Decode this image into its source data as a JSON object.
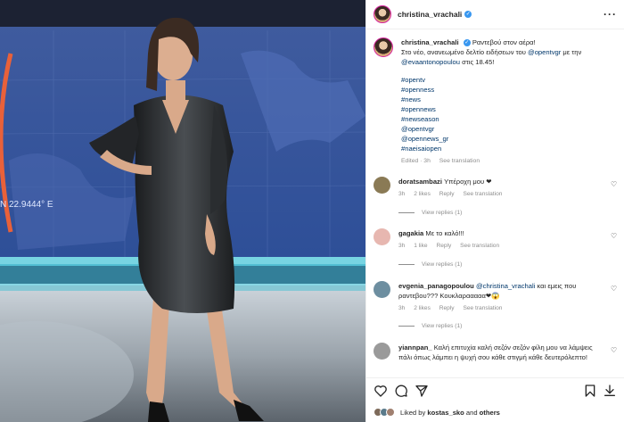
{
  "post": {
    "author": "christina_vrachali",
    "photo_text": "N 22.9444° E"
  },
  "caption": {
    "username": "christina_vrachali",
    "line1": "Ραντεβού στον αέρα!",
    "line2a": "Στο νέο, ανανεωμένο δελτίο ειδήσεων του ",
    "mention_opentvgr": "@opentvgr",
    "line2b": " με την",
    "mention_eva": "@evaantonopoulou",
    "line2c": " στις 18.45!",
    "hashtags": [
      "#opentv",
      "#openness",
      "#news",
      "#opennews",
      "#newseason",
      "@opentvgr",
      "@opennews_gr",
      "#naeisaiopen"
    ],
    "edited": "Edited · 3h",
    "see_translation": "See translation"
  },
  "comments": [
    {
      "username": "doratsambazi",
      "text": "Υπέροχη μου ❤",
      "time": "3h",
      "likes": "2 likes",
      "reply": "Reply",
      "translate": "See translation",
      "replies": "View replies (1)"
    },
    {
      "username": "gagakia",
      "text": "Με το καλό!!!",
      "time": "3h",
      "likes": "1 like",
      "reply": "Reply",
      "translate": "See translation",
      "replies": "View replies (1)"
    },
    {
      "username": "evgenia_panagopoulou",
      "mention": "@christina_vrachali",
      "text": " και εμεις που ραντεβου??? Κουκλαρααααα❤😱",
      "time": "3h",
      "likes": "2 likes",
      "reply": "Reply",
      "translate": "See translation",
      "replies": "View replies (1)"
    },
    {
      "username": "yiannpan_",
      "text": "Καλή επιτυχία καλή σεζόν σεζόν φίλη μου να λάμψεις πάλι όπως λάμπει η ψυχή σου κάθε στιγμή κάθε δευτερόλεπτο!"
    }
  ],
  "liked_by": {
    "prefix": "Liked by ",
    "user": "kostas_sko",
    "and": " and ",
    "others": "others"
  },
  "colors": {
    "verified": "#3897f0",
    "link": "#00376b",
    "heart": "#ed4956",
    "muted": "#8e8e8e"
  }
}
